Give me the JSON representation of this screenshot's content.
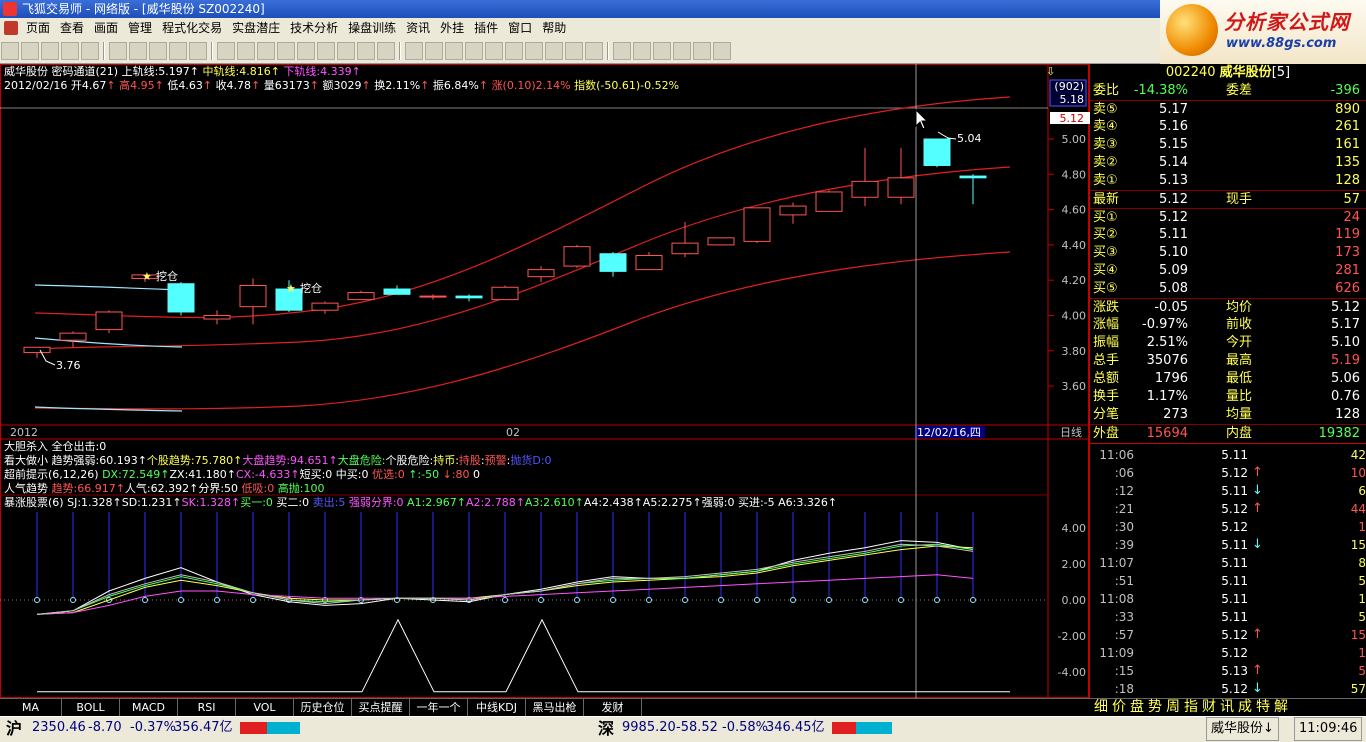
{
  "window": {
    "title": "飞狐交易师 - 网络版 - [威华股份 SZ002240]"
  },
  "menu": [
    "页面",
    "查看",
    "画面",
    "管理",
    "程式化交易",
    "实盘潜庄",
    "技术分析",
    "操盘训练",
    "资讯",
    "外挂",
    "插件",
    "窗口",
    "帮助"
  ],
  "toolbar": {
    "buttons": [
      "home",
      "back",
      "rsi-button",
      "cross",
      "minus",
      "权",
      "compare",
      "glasses",
      "chart",
      "box",
      "tools",
      "stop",
      "pie",
      "magnifier",
      "zoom-out",
      "pause",
      "grid",
      "table",
      "doc",
      "ruler",
      "pointer",
      "line",
      "hline",
      "vline",
      "parallel",
      "fan",
      "channel",
      "rect",
      "circle",
      "text",
      "copy",
      "erase",
      "delete",
      "colors",
      "save"
    ]
  },
  "logo": {
    "title": "分析家公式网",
    "url": "www.88gs.com"
  },
  "chart": {
    "header1": {
      "name": "威华股份",
      "ind": "密码通道(21)",
      "upper": "上轨线:5.197",
      "mid": "中轨线:4.816",
      "lower": "下轨线:4.339"
    },
    "header2": {
      "date": "2012/02/16",
      "open": "开4.67",
      "high": "高4.95",
      "low": "低4.63",
      "close": "收4.78",
      "vol": "量63173",
      "amt": "额3029",
      "turn": "换2.11%",
      "amp": "振6.84%",
      "chg": "涨(0.10)2.14%",
      "idx": "指数(-50.61)-0.52%"
    },
    "price_axis": [
      "5.00",
      "4.80",
      "4.60",
      "4.40",
      "4.20",
      "4.00",
      "3.80",
      "3.60"
    ],
    "ind_axis": [
      "4.00",
      "2.00",
      "0.00",
      "-2.00",
      "-4.00"
    ],
    "axis_box": {
      "code": "(902)",
      "price": "5.18"
    },
    "marker_price": "5.12",
    "high_label": "5.04",
    "low_label": "3.76",
    "signal1": "挖仓",
    "signal2": "挖仓",
    "x_labels": {
      "year": "2012",
      "month": "02",
      "cursor": "12/02/16,四",
      "period": "日线"
    },
    "signals": [
      {
        "parts": [
          [
            "大胆杀入",
            "wht"
          ],
          [
            " 全仓出击:0",
            "wht"
          ]
        ]
      },
      {
        "parts": [
          [
            "看大做小",
            "wht"
          ],
          [
            " 趋势强弱:60.193↑",
            "wht"
          ],
          [
            "个股趋势:75.780↑",
            "yel"
          ],
          [
            "大盘趋势:94.651↑",
            "mag"
          ],
          [
            "大盘危险:",
            "green"
          ],
          [
            "个股危险:",
            "wht"
          ],
          [
            "持币",
            "yel"
          ],
          [
            ":",
            "wht"
          ],
          [
            "持股",
            "red"
          ],
          [
            ":",
            "wht"
          ],
          [
            "预警",
            "red"
          ],
          [
            ":",
            "wht"
          ],
          [
            "抛货D:0",
            "blu"
          ]
        ]
      },
      {
        "parts": [
          [
            "超前提示(6,12,26)",
            "wht"
          ],
          [
            " DX:72.549↑",
            "green"
          ],
          [
            "ZX:41.180↑",
            "wht"
          ],
          [
            "CX:-4.633↑",
            "mag"
          ],
          [
            "短买:0",
            "wht"
          ],
          [
            " 中买:0",
            "wht"
          ],
          [
            " 优选:0",
            "red"
          ],
          [
            " ↑:-50",
            "green"
          ],
          [
            " ↓:80",
            "red"
          ],
          [
            " 0",
            "wht"
          ]
        ]
      },
      {
        "parts": [
          [
            "人气趋势",
            "wht"
          ],
          [
            " 趋势:66.917↑",
            "red"
          ],
          [
            "人气:62.392↑",
            "wht"
          ],
          [
            "分界:50",
            "wht"
          ],
          [
            " 低吸:0",
            "red"
          ],
          [
            " 高抛:100",
            "green"
          ]
        ]
      },
      {
        "parts": [
          [
            "暴涨股票(6)",
            "wht"
          ],
          [
            " SJ:1.328↑",
            "wht"
          ],
          [
            "SD:1.231↑",
            "wht"
          ],
          [
            "SK:1.328↑",
            "mag"
          ],
          [
            "买一:0",
            "green"
          ],
          [
            " 买二:0",
            "wht"
          ],
          [
            " 卖出:5",
            "blu"
          ],
          [
            " 强弱分界:0",
            "mag"
          ],
          [
            " A1:2.967↑",
            "green"
          ],
          [
            "A2:2.788↑",
            "mag"
          ],
          [
            "A3:2.610↑",
            "green"
          ],
          [
            "A4:2.438↑",
            "wht"
          ],
          [
            "A5:2.275↑",
            "wht"
          ],
          [
            "强弱:0",
            "wht"
          ],
          [
            " 买进:-5",
            "wht"
          ],
          [
            " A6:3.326↑",
            "wht"
          ]
        ]
      }
    ]
  },
  "quote": {
    "code": "002240",
    "name": "威华股份",
    "count": "[5]",
    "rows": [
      {
        "l1": "委比",
        "v1": "-14.38%",
        "c1": "green",
        "l2": "委差",
        "v2": "-396",
        "c2": "green"
      },
      {
        "l1": "卖⑤",
        "v1": "5.17",
        "c1": "wht",
        "l2": "",
        "v2": "890",
        "c2": "yel"
      },
      {
        "l1": "卖④",
        "v1": "5.16",
        "c1": "wht",
        "l2": "",
        "v2": "261",
        "c2": "yel"
      },
      {
        "l1": "卖③",
        "v1": "5.15",
        "c1": "wht",
        "l2": "",
        "v2": "161",
        "c2": "yel"
      },
      {
        "l1": "卖②",
        "v1": "5.14",
        "c1": "wht",
        "l2": "",
        "v2": "135",
        "c2": "yel"
      },
      {
        "l1": "卖①",
        "v1": "5.13",
        "c1": "wht",
        "l2": "",
        "v2": "128",
        "c2": "yel"
      },
      {
        "l1": "最新",
        "v1": "5.12",
        "c1": "wht",
        "l2": "现手",
        "v2": "57",
        "c2": "yel"
      },
      {
        "l1": "买①",
        "v1": "5.12",
        "c1": "wht",
        "l2": "",
        "v2": "24",
        "c2": "red"
      },
      {
        "l1": "买②",
        "v1": "5.11",
        "c1": "wht",
        "l2": "",
        "v2": "119",
        "c2": "red"
      },
      {
        "l1": "买③",
        "v1": "5.10",
        "c1": "wht",
        "l2": "",
        "v2": "173",
        "c2": "red"
      },
      {
        "l1": "买④",
        "v1": "5.09",
        "c1": "wht",
        "l2": "",
        "v2": "281",
        "c2": "red"
      },
      {
        "l1": "买⑤",
        "v1": "5.08",
        "c1": "wht",
        "l2": "",
        "v2": "626",
        "c2": "red"
      },
      {
        "l1": "涨跌",
        "v1": "-0.05",
        "c1": "wht",
        "l2": "均价",
        "v2": "5.12",
        "c2": "wht"
      },
      {
        "l1": "涨幅",
        "v1": "-0.97%",
        "c1": "wht",
        "l2": "前收",
        "v2": "5.17",
        "c2": "wht"
      },
      {
        "l1": "振幅",
        "v1": "2.51%",
        "c1": "wht",
        "l2": "今开",
        "v2": "5.10",
        "c2": "wht"
      },
      {
        "l1": "总手",
        "v1": "35076",
        "c1": "wht",
        "l2": "最高",
        "v2": "5.19",
        "c2": "red"
      },
      {
        "l1": "总额",
        "v1": "1796",
        "c1": "wht",
        "l2": "最低",
        "v2": "5.06",
        "c2": "wht"
      },
      {
        "l1": "换手",
        "v1": "1.17%",
        "c1": "wht",
        "l2": "量比",
        "v2": "0.76",
        "c2": "wht"
      },
      {
        "l1": "分笔",
        "v1": "273",
        "c1": "wht",
        "l2": "均量",
        "v2": "128",
        "c2": "wht"
      },
      {
        "l1": "外盘",
        "v1": "15694",
        "c1": "red",
        "l2": "内盘",
        "v2": "19382",
        "c2": "green"
      }
    ],
    "ticks": [
      {
        "t": "11:06",
        "p": "5.11",
        "pc": "wht",
        "a": "",
        "v": "42",
        "vc": "yel"
      },
      {
        "t": ":06",
        "p": "5.12",
        "pc": "wht",
        "a": "↑",
        "ac": "red",
        "v": "10",
        "vc": "red"
      },
      {
        "t": ":12",
        "p": "5.11",
        "pc": "wht",
        "a": "↓",
        "ac": "cyan",
        "v": "6",
        "vc": "yel"
      },
      {
        "t": ":21",
        "p": "5.12",
        "pc": "wht",
        "a": "↑",
        "ac": "red",
        "v": "44",
        "vc": "red"
      },
      {
        "t": ":30",
        "p": "5.12",
        "pc": "wht",
        "a": "",
        "v": "1",
        "vc": "red"
      },
      {
        "t": ":39",
        "p": "5.11",
        "pc": "wht",
        "a": "↓",
        "ac": "cyan",
        "v": "15",
        "vc": "yel"
      },
      {
        "t": "11:07",
        "p": "5.11",
        "pc": "wht",
        "a": "",
        "v": "8",
        "vc": "yel"
      },
      {
        "t": ":51",
        "p": "5.11",
        "pc": "wht",
        "a": "",
        "v": "5",
        "vc": "yel"
      },
      {
        "t": "11:08",
        "p": "5.11",
        "pc": "wht",
        "a": "",
        "v": "1",
        "vc": "yel"
      },
      {
        "t": ":33",
        "p": "5.11",
        "pc": "wht",
        "a": "",
        "v": "5",
        "vc": "yel"
      },
      {
        "t": ":57",
        "p": "5.12",
        "pc": "wht",
        "a": "↑",
        "ac": "red",
        "v": "15",
        "vc": "red"
      },
      {
        "t": "11:09",
        "p": "5.12",
        "pc": "wht",
        "a": "",
        "v": "1",
        "vc": "red"
      },
      {
        "t": ":15",
        "p": "5.13",
        "pc": "wht",
        "a": "↑",
        "ac": "red",
        "v": "5",
        "vc": "red"
      },
      {
        "t": ":18",
        "p": "5.12",
        "pc": "wht",
        "a": "↓",
        "ac": "cyan",
        "v": "57",
        "vc": "yel"
      }
    ]
  },
  "bottom_tabs": [
    "MA",
    "BOLL",
    "MACD",
    "RSI",
    "VOL",
    "历史仓位",
    "买点提醒",
    "一年一个",
    "中线KDJ",
    "黑马出枪",
    "发财"
  ],
  "right_tabs": "细价盘势周指财讯成特解",
  "status": {
    "sh_label": "沪",
    "sh_index": "2350.46",
    "sh_chg": "-8.70",
    "sh_pct": "-0.37%",
    "sh_amt": "356.47亿",
    "sz_label": "深",
    "sz_index": "9985.20",
    "sz_chg": "-58.52",
    "sz_pct": "-0.58%",
    "sz_amt": "346.45亿",
    "stock": "威华股份↓",
    "time": "11:09:46"
  },
  "colors": {
    "up": "#ff5454",
    "down": "#54ffff",
    "band": "#e02020",
    "frame": "#c00000",
    "grid": "#800000"
  }
}
